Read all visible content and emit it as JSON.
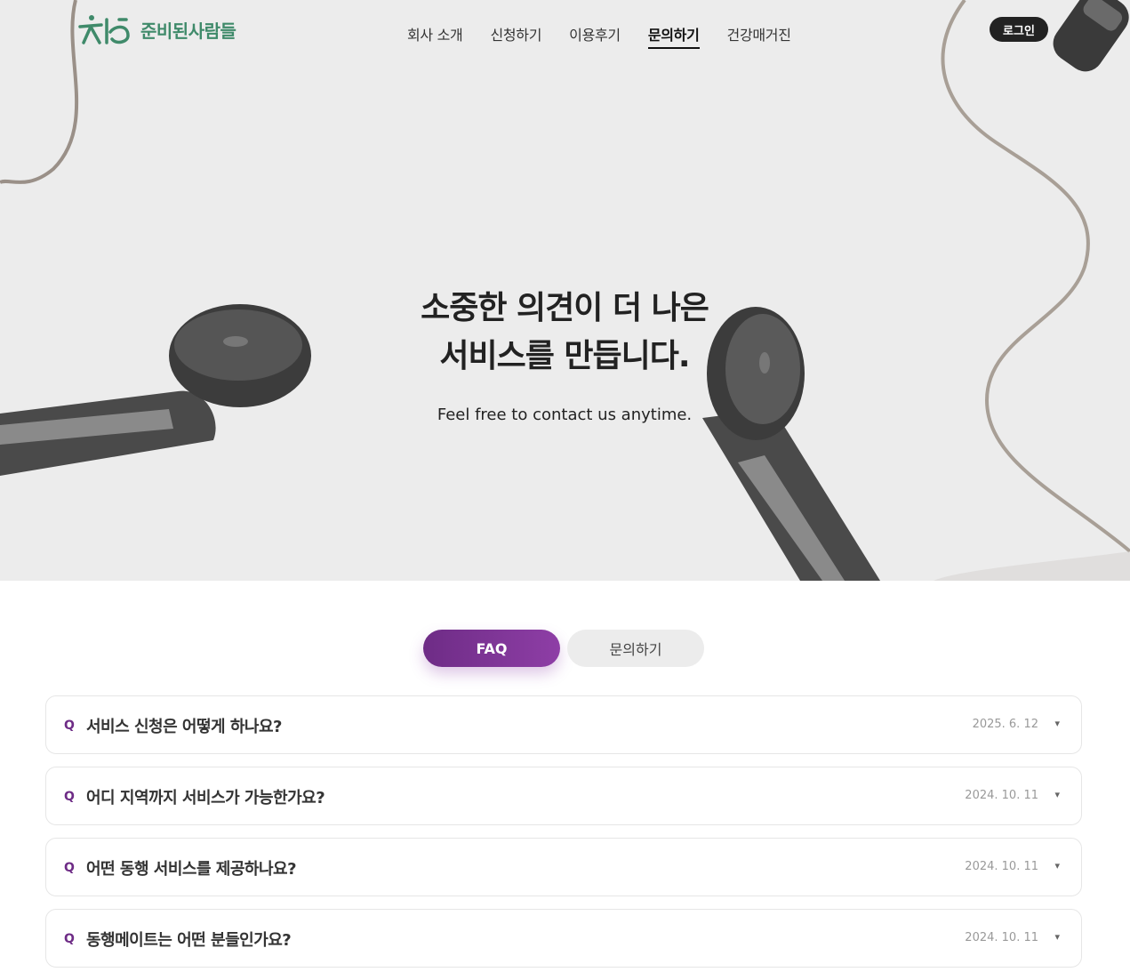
{
  "header": {
    "logo_text": "준비된사람들",
    "nav": [
      "회사 소개",
      "신청하기",
      "이용후기",
      "문의하기",
      "건강매거진"
    ],
    "active_nav": "문의하기",
    "login_label": "로그인"
  },
  "hero": {
    "title_line1": "소중한 의견이 더 나은",
    "title_line2": "서비스를 만듭니다.",
    "subtitle": "Feel free to contact us anytime."
  },
  "tabs": {
    "faq_label": "FAQ",
    "inquiry_label": "문의하기"
  },
  "faq": [
    {
      "q": "Q",
      "title": "서비스 신청은 어떻게 하나요?",
      "date": "2025. 6. 12",
      "toggle": "▾"
    },
    {
      "q": "Q",
      "title": "어디 지역까지 서비스가 가능한가요?",
      "date": "2024. 10. 11",
      "toggle": "▾"
    },
    {
      "q": "Q",
      "title": "어떤 동행 서비스를 제공하나요?",
      "date": "2024. 10. 11",
      "toggle": "▾"
    },
    {
      "q": "Q",
      "title": "동행메이트는 어떤 분들인가요?",
      "date": "2024. 10. 11",
      "toggle": "▾"
    }
  ],
  "colors": {
    "brand_green": "#3f8a6a",
    "accent_purple": "#7a3394",
    "hero_bg": "#ececec"
  }
}
